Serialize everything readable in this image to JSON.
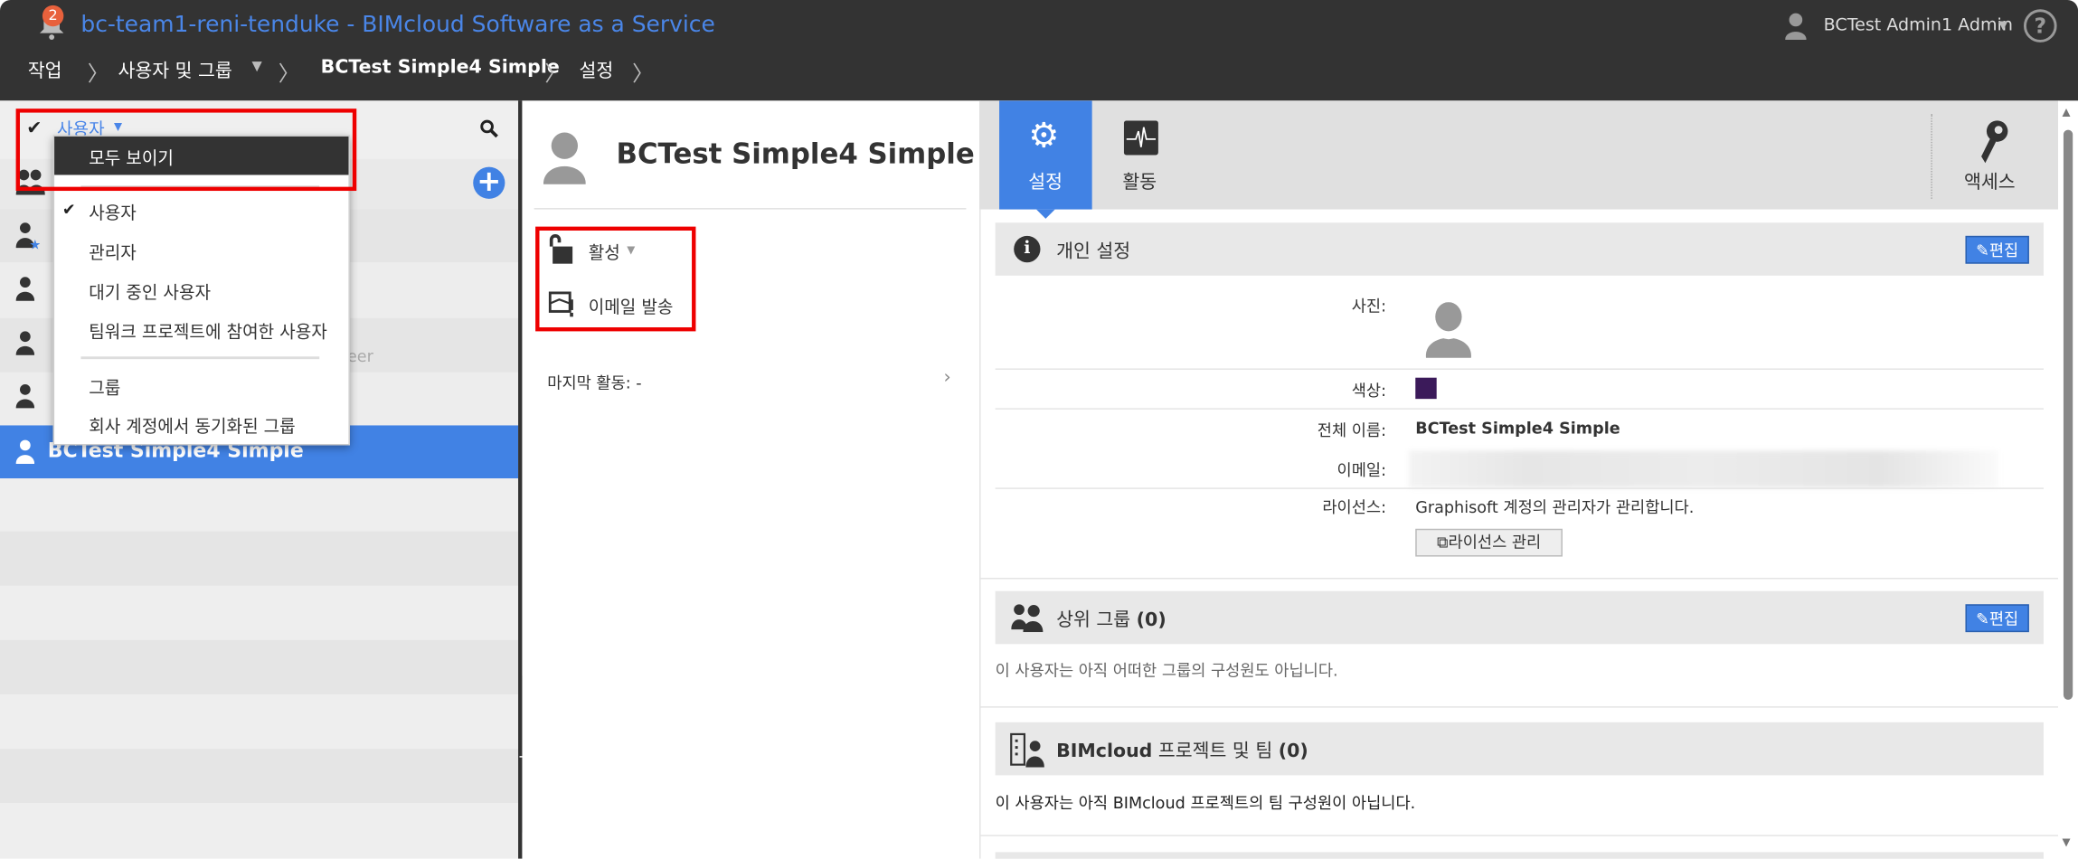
{
  "header": {
    "notification_count": "2",
    "title": "bc-team1-reni-tenduke - BIMcloud Software as a Service",
    "breadcrumb": [
      "작업",
      "사용자 및 그룹",
      "BCTest Simple4 Simple",
      "설정"
    ],
    "user_name": "BCTest Admin1 Admin",
    "help": "?"
  },
  "left_panel": {
    "filter_label": "사용자",
    "partial_text": "eer",
    "selected_user": "BCTest Simple4 Simple"
  },
  "dropdown": {
    "show_all": "모두 보이기",
    "items": [
      "사용자",
      "관리자",
      "대기 중인 사용자",
      "팀워크 프로젝트에 참여한 사용자"
    ],
    "group_items": [
      "그룹",
      "회사 계정에서 동기화된 그룹"
    ],
    "checked": "사용자"
  },
  "middle": {
    "name": "BCTest Simple4 Simple",
    "status": "활성",
    "send_email": "이메일 발송",
    "last_activity": "마지막 활동: -"
  },
  "tabs": {
    "settings": "설정",
    "activity": "활동",
    "access": "액세스"
  },
  "personal": {
    "title": "개인 설정",
    "edit": "편집",
    "photo_label": "사진:",
    "color_label": "색상:",
    "color": "#3b1a5a",
    "fullname_label": "전체 이름:",
    "fullname": "BCTest Simple4 Simple",
    "email_label": "이메일:",
    "license_label": "라이선스:",
    "license_value": "Graphisoft 계정의 관리자가 관리합니다.",
    "license_button": "라이선스 관리"
  },
  "groups": {
    "title": "상위 그룹",
    "count": "(0)",
    "edit": "편집",
    "empty": "이 사용자는 아직 어떠한 그룹의 구성원도 아닙니다."
  },
  "projects": {
    "title_bold": "BIMcloud",
    "title": " 프로젝트 및 팀 ",
    "count": "(0)",
    "empty": "이 사용자는 아직 BIMcloud 프로젝트의 팀 구성원이 아닙니다."
  },
  "colors": {
    "accent": "#4182e4",
    "header": "#333333",
    "highlight": "#ee0000"
  }
}
